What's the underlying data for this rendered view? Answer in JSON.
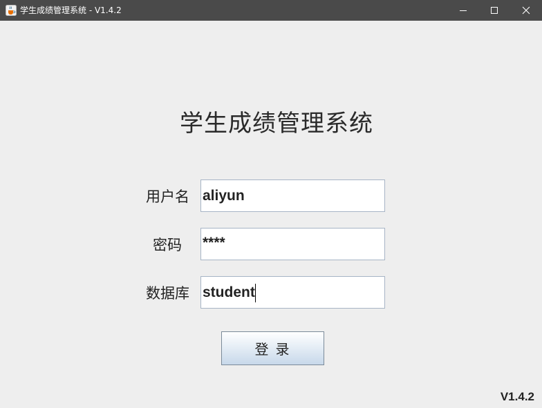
{
  "window": {
    "title": "学生成绩管理系统 - V1.4.2",
    "icon": "java-cup-icon"
  },
  "controls": {
    "minimize": "minimize-icon",
    "maximize": "maximize-icon",
    "close": "close-icon"
  },
  "form": {
    "heading": "学生成绩管理系统",
    "username_label": "用户名",
    "username_value": "aliyun",
    "password_label": "密码",
    "password_value": "****",
    "database_label": "数据库",
    "database_value": "student",
    "login_label": "登录"
  },
  "footer": {
    "version": "V1.4.2"
  }
}
